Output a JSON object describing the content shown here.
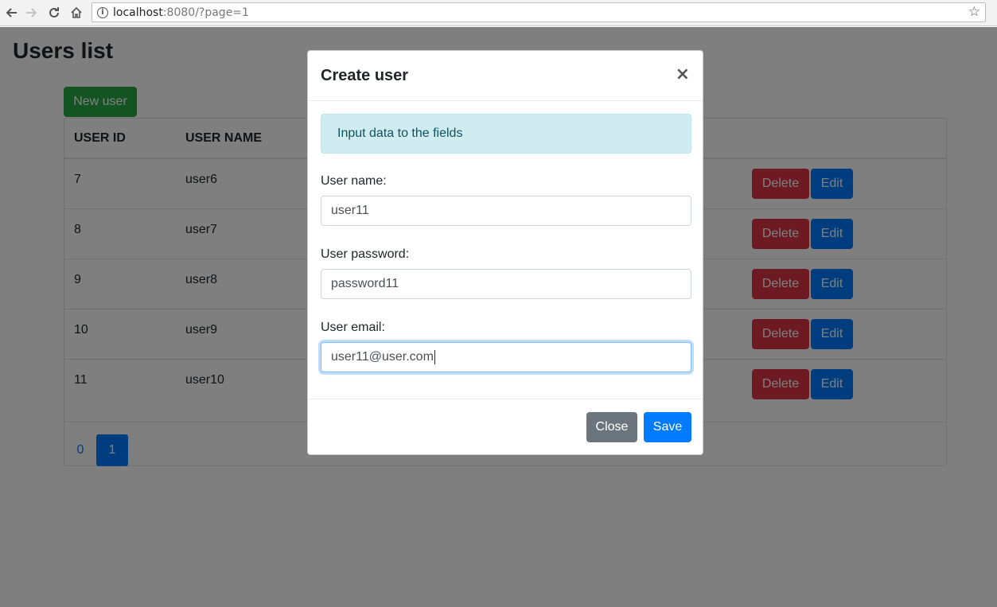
{
  "browser": {
    "url_host": "localhost",
    "url_rest": ":8080/?page=1"
  },
  "page": {
    "title": "Users list",
    "new_user_label": "New user",
    "table": {
      "headers": [
        "USER ID",
        "USER NAME"
      ],
      "rows": [
        {
          "id": "7",
          "name": "user6"
        },
        {
          "id": "8",
          "name": "user7"
        },
        {
          "id": "9",
          "name": "user8"
        },
        {
          "id": "10",
          "name": "user9"
        },
        {
          "id": "11",
          "name": "user10"
        }
      ],
      "delete_label": "Delete",
      "edit_label": "Edit"
    },
    "pagination": [
      "0",
      "1"
    ],
    "active_page": "1"
  },
  "modal": {
    "title": "Create user",
    "close_symbol": "×",
    "alert": "Input data to the fields",
    "fields": [
      {
        "label": "User name:",
        "value": "user11"
      },
      {
        "label": "User password:",
        "value": "password11"
      },
      {
        "label": "User email:",
        "value": "user11@user.com"
      }
    ],
    "close_label": "Close",
    "save_label": "Save"
  },
  "colors": {
    "primary": "#007bff",
    "success": "#28a745",
    "danger": "#dc3545",
    "secondary": "#6c757d",
    "alert_bg": "#d1ecf1"
  },
  "icons": [
    "back-arrow-icon",
    "forward-arrow-icon",
    "reload-icon",
    "home-icon",
    "info-icon",
    "star-icon",
    "close-icon"
  ]
}
